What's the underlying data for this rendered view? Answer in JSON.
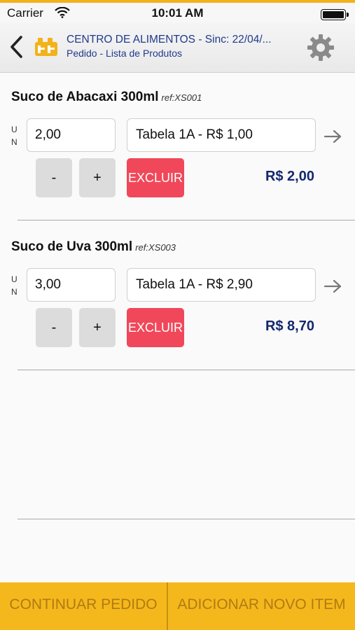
{
  "status_bar": {
    "carrier": "Carrier",
    "time": "10:01 AM"
  },
  "header": {
    "title": "CENTRO DE ALIMENTOS - Sinc: 22/04/...",
    "subtitle": "Pedido - Lista de Produtos"
  },
  "items": [
    {
      "name": "Suco de Abacaxi 300ml",
      "ref": "ref:XS001",
      "unit_top": "U",
      "unit_bottom": "N",
      "quantity": "2,00",
      "price_table": "Tabela 1A - R$ 1,00",
      "minus_label": "-",
      "plus_label": "+",
      "delete_label": "EXCLUIR",
      "total": "R$ 2,00"
    },
    {
      "name": "Suco de Uva 300ml",
      "ref": "ref:XS003",
      "unit_top": "U",
      "unit_bottom": "N",
      "quantity": "3,00",
      "price_table": "Tabela 1A - R$ 2,90",
      "minus_label": "-",
      "plus_label": "+",
      "delete_label": "EXCLUIR",
      "total": "R$ 8,70"
    }
  ],
  "footer": {
    "continue_label": "CONTINUAR PEDIDO",
    "add_item_label": "ADICIONAR NOVO ITEM"
  },
  "colors": {
    "accent": "#f5b81c",
    "delete": "#f0485a",
    "price": "#14286e",
    "header_text": "#1f3a8a"
  },
  "icons": [
    "wifi-icon",
    "battery-icon",
    "back-chevron-icon",
    "app-logo-icon",
    "gear-icon",
    "arrow-right-icon"
  ]
}
